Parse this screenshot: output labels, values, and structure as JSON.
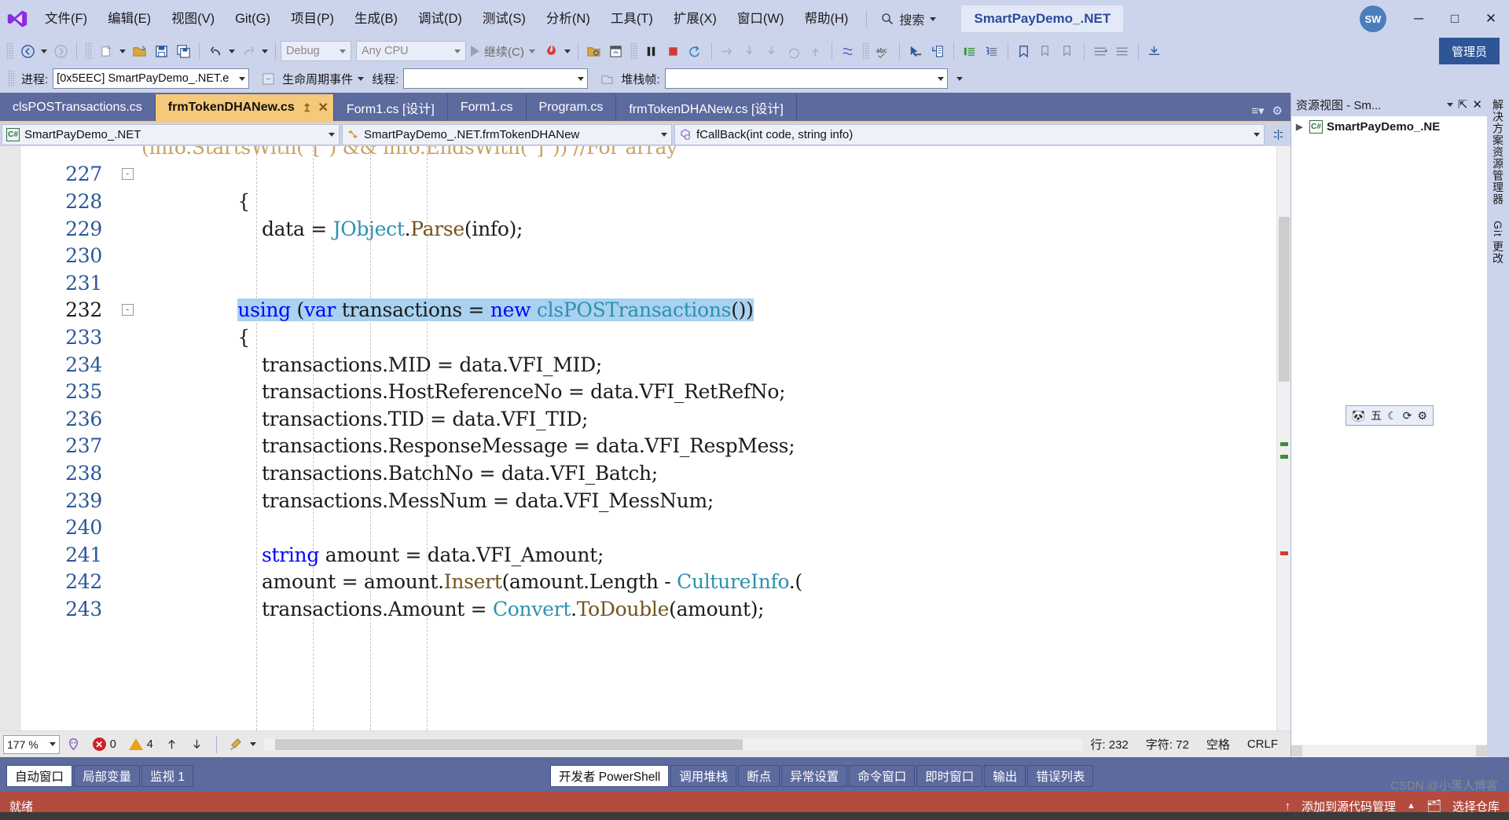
{
  "titlebar": {
    "logo_icon": "visual-studio-logo",
    "menus": [
      "文件(F)",
      "编辑(E)",
      "视图(V)",
      "Git(G)",
      "项目(P)",
      "生成(B)",
      "调试(D)",
      "测试(S)",
      "分析(N)",
      "工具(T)",
      "扩展(X)",
      "窗口(W)",
      "帮助(H)"
    ],
    "search_placeholder": "搜索",
    "search_icon": "search-icon",
    "solution_name": "SmartPayDemo_.NET",
    "account_initials": "SW",
    "minimize": "─",
    "maximize": "□",
    "close": "✕"
  },
  "toolbar": {
    "nav_back_icon": "navigate-back-icon",
    "nav_forward_icon": "navigate-forward-icon",
    "new_item_icon": "new-item-icon",
    "open_file_icon": "open-file-icon",
    "save_icon": "save-icon",
    "save_all_icon": "save-all-icon",
    "undo_icon": "undo-icon",
    "redo_icon": "redo-icon",
    "config_value": "Debug",
    "platform_value": "Any CPU",
    "continue_label": "继续(C)",
    "hot_reload_icon": "hot-reload-icon",
    "attach_icon": "attach-to-process-icon",
    "window_icon": "window-layout-icon",
    "pause_icon": "pause-icon",
    "stop_icon": "stop-icon",
    "restart_icon": "restart-icon",
    "step_over_icon": "step-over-icon",
    "step_into_icon": "step-into-icon",
    "step_out_icon": "step-out-icon",
    "cycle_icon": "cycle-clipboard-icon",
    "spell_icon": "abc-spellcheck-icon",
    "pointer_icon": "pointer-select-icon",
    "indent_icon": "indent-icon",
    "comment_icon": "comment-icon",
    "uncomment_icon": "uncomment-icon",
    "bookmark_icon": "bookmark-icon",
    "expand_icon": "expand-icon",
    "collapse_icon": "collapse-icon",
    "admin_label": "管理员"
  },
  "debugbar": {
    "process_label": "进程:",
    "process_value": "[0x5EEC] SmartPayDemo_.NET.e",
    "lifecycle_icon": "lifecycle-events-icon",
    "lifecycle_label": "生命周期事件",
    "thread_label": "线程:",
    "thread_value": "",
    "stackframe_icon": "stack-frame-icon",
    "stackframe_label": "堆栈帧:",
    "stackframe_value": ""
  },
  "tabs": [
    {
      "label": "clsPOSTransactions.cs",
      "active": false
    },
    {
      "label": "frmTokenDHANew.cs",
      "active": true,
      "pin": "↥",
      "close": "✕"
    },
    {
      "label": "Form1.cs [设计]",
      "active": false
    },
    {
      "label": "Form1.cs",
      "active": false
    },
    {
      "label": "Program.cs",
      "active": false
    },
    {
      "label": "frmTokenDHANew.cs [设计]",
      "active": false
    }
  ],
  "navbar": {
    "project_icon": "csharp-project-icon",
    "project": "SmartPayDemo_.NET",
    "class_icon": "class-icon",
    "class": "SmartPayDemo_.NET.frmTokenDHANew",
    "member_icon": "method-private-icon",
    "member": "fCallBack(int code, string info)",
    "split_icon": "split-view-icon"
  },
  "editor": {
    "first_line_partial": "(info.StartsWith(\"[\") && info.EndsWith(\"]\")) //For array",
    "lines": [
      {
        "n": "227",
        "fold": "-",
        "segments": []
      },
      {
        "n": "228",
        "indent": 4,
        "segments": [
          {
            "t": "{",
            "c": "id"
          }
        ]
      },
      {
        "n": "229",
        "indent": 5,
        "segments": [
          {
            "t": "data",
            "c": "id"
          },
          {
            "t": " = ",
            "c": "id"
          },
          {
            "t": "JObject",
            "c": "typ"
          },
          {
            "t": ".",
            "c": "id"
          },
          {
            "t": "Parse",
            "c": "fn"
          },
          {
            "t": "(info);",
            "c": "id"
          }
        ]
      },
      {
        "n": "230",
        "indent": 0,
        "segments": []
      },
      {
        "n": "231",
        "indent": 0,
        "segments": []
      },
      {
        "n": "232",
        "fold": "-",
        "current": true,
        "highlight": true,
        "indent": 4,
        "segments": [
          {
            "t": "using",
            "c": "kw"
          },
          {
            "t": " (",
            "c": "id"
          },
          {
            "t": "var",
            "c": "kw"
          },
          {
            "t": " transactions = ",
            "c": "id"
          },
          {
            "t": "new",
            "c": "kw"
          },
          {
            "t": " ",
            "c": "id"
          },
          {
            "t": "clsPOSTransactions",
            "c": "typ"
          },
          {
            "t": "())",
            "c": "id"
          }
        ]
      },
      {
        "n": "233",
        "indent": 4,
        "segments": [
          {
            "t": "{",
            "c": "id"
          }
        ]
      },
      {
        "n": "234",
        "indent": 5,
        "segments": [
          {
            "t": "transactions",
            "c": "id"
          },
          {
            "t": ".",
            "c": "id"
          },
          {
            "t": "MID = ",
            "c": "id"
          },
          {
            "t": "data",
            "c": "id"
          },
          {
            "t": ".",
            "c": "id"
          },
          {
            "t": "VFI_MID;",
            "c": "id"
          }
        ]
      },
      {
        "n": "235",
        "indent": 5,
        "segments": [
          {
            "t": "transactions",
            "c": "id"
          },
          {
            "t": ".",
            "c": "id"
          },
          {
            "t": "HostReferenceNo = ",
            "c": "id"
          },
          {
            "t": "data",
            "c": "id"
          },
          {
            "t": ".",
            "c": "id"
          },
          {
            "t": "VFI_RetRefNo;",
            "c": "id"
          }
        ]
      },
      {
        "n": "236",
        "indent": 5,
        "segments": [
          {
            "t": "transactions",
            "c": "id"
          },
          {
            "t": ".",
            "c": "id"
          },
          {
            "t": "TID = ",
            "c": "id"
          },
          {
            "t": "data",
            "c": "id"
          },
          {
            "t": ".",
            "c": "id"
          },
          {
            "t": "VFI_TID;",
            "c": "id"
          }
        ]
      },
      {
        "n": "237",
        "indent": 5,
        "segments": [
          {
            "t": "transactions",
            "c": "id"
          },
          {
            "t": ".",
            "c": "id"
          },
          {
            "t": "ResponseMessage = ",
            "c": "id"
          },
          {
            "t": "data",
            "c": "id"
          },
          {
            "t": ".",
            "c": "id"
          },
          {
            "t": "VFI_RespMess;",
            "c": "id"
          }
        ]
      },
      {
        "n": "238",
        "indent": 5,
        "segments": [
          {
            "t": "transactions",
            "c": "id"
          },
          {
            "t": ".",
            "c": "id"
          },
          {
            "t": "BatchNo = ",
            "c": "id"
          },
          {
            "t": "data",
            "c": "id"
          },
          {
            "t": ".",
            "c": "id"
          },
          {
            "t": "VFI_Batch;",
            "c": "id"
          }
        ]
      },
      {
        "n": "239",
        "indent": 5,
        "segments": [
          {
            "t": "transactions",
            "c": "id"
          },
          {
            "t": ".",
            "c": "id"
          },
          {
            "t": "MessNum = ",
            "c": "id"
          },
          {
            "t": "data",
            "c": "id"
          },
          {
            "t": ".",
            "c": "id"
          },
          {
            "t": "VFI_MessNum;",
            "c": "id"
          }
        ]
      },
      {
        "n": "240",
        "indent": 0,
        "segments": []
      },
      {
        "n": "241",
        "indent": 5,
        "segments": [
          {
            "t": "string",
            "c": "kw"
          },
          {
            "t": " amount = ",
            "c": "id"
          },
          {
            "t": "data",
            "c": "id"
          },
          {
            "t": ".",
            "c": "id"
          },
          {
            "t": "VFI_Amount;",
            "c": "id"
          }
        ]
      },
      {
        "n": "242",
        "indent": 5,
        "segments": [
          {
            "t": "amount = amount",
            "c": "id"
          },
          {
            "t": ".",
            "c": "id"
          },
          {
            "t": "Insert",
            "c": "fn"
          },
          {
            "t": "(amount",
            "c": "id"
          },
          {
            "t": ".",
            "c": "id"
          },
          {
            "t": "Length - ",
            "c": "id"
          },
          {
            "t": "CultureInfo",
            "c": "typ"
          },
          {
            "t": ".(",
            "c": "id"
          }
        ]
      },
      {
        "n": "243",
        "indent": 5,
        "segments": [
          {
            "t": "transactions",
            "c": "id"
          },
          {
            "t": ".",
            "c": "id"
          },
          {
            "t": "Amount = ",
            "c": "id"
          },
          {
            "t": "Convert",
            "c": "typ"
          },
          {
            "t": ".",
            "c": "id"
          },
          {
            "t": "ToDouble",
            "c": "fn"
          },
          {
            "t": "(amount);",
            "c": "id"
          }
        ]
      }
    ],
    "breakpoint_icon": "breakpoint-arrow-icon"
  },
  "editor_status": {
    "zoom": "177 %",
    "feedback_icon": "feedback-icon",
    "error_count": "0",
    "warning_count": "4",
    "prev_icon": "prev-issue-icon",
    "next_icon": "next-issue-icon",
    "cleanup_icon": "code-cleanup-icon",
    "line_label": "行: 232",
    "col_label": "字符: 72",
    "space_label": "空格",
    "eol_label": "CRLF"
  },
  "rightpanel": {
    "title": "资源视图 - Sm...",
    "dropdown_icon": "chevron-down-icon",
    "pin_icon": "pin-icon",
    "close_icon": "close-icon",
    "tree_root_icon": "csharp-project-icon",
    "tree_root": "SmartPayDemo_.NE",
    "expander": "▶",
    "vertical_tabs": [
      "解决方案资源管理器",
      "Git 更改"
    ]
  },
  "float_toolbar": {
    "panda_icon": "panda-icon",
    "label": "五",
    "moon_icon": "moon-icon",
    "refresh_icon": "refresh-icon",
    "gear_icon": "gear-icon"
  },
  "bottomdock": {
    "left_tabs": [
      {
        "label": "自动窗口",
        "active": true
      },
      {
        "label": "局部变量",
        "active": false
      },
      {
        "label": "监视 1",
        "active": false
      }
    ],
    "right_tabs": [
      {
        "label": "开发者 PowerShell",
        "active": true
      },
      {
        "label": "调用堆栈",
        "active": false
      },
      {
        "label": "断点",
        "active": false
      },
      {
        "label": "异常设置",
        "active": false
      },
      {
        "label": "命令窗口",
        "active": false
      },
      {
        "label": "即时窗口",
        "active": false
      },
      {
        "label": "输出",
        "active": false
      },
      {
        "label": "错误列表",
        "active": false
      }
    ]
  },
  "statusbar": {
    "ready": "就绪",
    "source_control_icon": "up-arrow-icon",
    "source_control": "添加到源代码管理",
    "caret": "▲",
    "select_repo_icon": "repo-icon",
    "select_repo": "选择仓库"
  },
  "watermark": "CSDN @小黑人博客",
  "colors": {
    "chrome": "#ccd4ec",
    "tab_active": "#f5c97b",
    "dock": "#5c6a9e",
    "status": "#b34b3f",
    "highlight": "#a8d2f0",
    "accent_blue": "#2b579a"
  }
}
